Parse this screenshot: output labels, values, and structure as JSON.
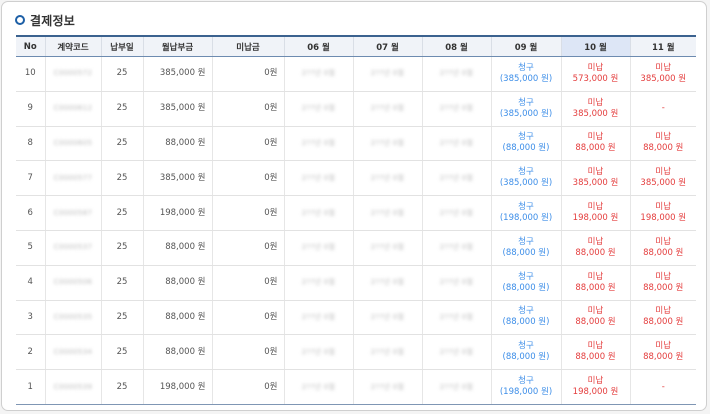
{
  "section": {
    "title": "결제정보"
  },
  "columns": [
    "No",
    "계약코드",
    "납부일",
    "월납부금",
    "미납금",
    "06 월",
    "07 월",
    "08 월",
    "09 월",
    "10 월",
    "11 월"
  ],
  "highlighted_column": "10 월",
  "colors": {
    "accent": "#3b628f",
    "billed": "#3d8ee8",
    "unpaid": "#e43d3d",
    "highlight": "#dde6f6"
  },
  "rows": [
    {
      "no": "10",
      "contract": "C0000572",
      "day": "25",
      "monthly": "385,000 원",
      "unpaid": "0원",
      "m06": "2??년 0월",
      "m07": "2??년 0월",
      "m08": "2??년 0월",
      "m09": {
        "status": "청구",
        "amount": "(385,000 원)"
      },
      "m10": {
        "status": "미납",
        "amount": "573,000 원"
      },
      "m11": {
        "status": "미납",
        "amount": "385,000 원"
      }
    },
    {
      "no": "9",
      "contract": "C0000612",
      "day": "25",
      "monthly": "385,000 원",
      "unpaid": "0원",
      "m06": "2??년 0월",
      "m07": "2??년 0월",
      "m08": "2??년 0월",
      "m09": {
        "status": "청구",
        "amount": "(385,000 원)"
      },
      "m10": {
        "status": "미납",
        "amount": "385,000 원"
      },
      "m11": {
        "status": "-",
        "amount": ""
      }
    },
    {
      "no": "8",
      "contract": "C0000605",
      "day": "25",
      "monthly": "88,000 원",
      "unpaid": "0원",
      "m06": "2??년 0월",
      "m07": "2??년 0월",
      "m08": "2??년 0월",
      "m09": {
        "status": "청구",
        "amount": "(88,000 원)"
      },
      "m10": {
        "status": "미납",
        "amount": "88,000 원"
      },
      "m11": {
        "status": "미납",
        "amount": "88,000 원"
      }
    },
    {
      "no": "7",
      "contract": "C0000577",
      "day": "25",
      "monthly": "385,000 원",
      "unpaid": "0원",
      "m06": "2??년 0월",
      "m07": "2??년 0월",
      "m08": "2??년 0월",
      "m09": {
        "status": "청구",
        "amount": "(385,000 원)"
      },
      "m10": {
        "status": "미납",
        "amount": "385,000 원"
      },
      "m11": {
        "status": "미납",
        "amount": "385,000 원"
      }
    },
    {
      "no": "6",
      "contract": "C0000587",
      "day": "25",
      "monthly": "198,000 원",
      "unpaid": "0원",
      "m06": "2??년 0월",
      "m07": "2??년 0월",
      "m08": "2??년 0월",
      "m09": {
        "status": "청구",
        "amount": "(198,000 원)"
      },
      "m10": {
        "status": "미납",
        "amount": "198,000 원"
      },
      "m11": {
        "status": "미납",
        "amount": "198,000 원"
      }
    },
    {
      "no": "5",
      "contract": "C0000537",
      "day": "25",
      "monthly": "88,000 원",
      "unpaid": "0원",
      "m06": "2??년 0월",
      "m07": "2??년 0월",
      "m08": "2??년 0월",
      "m09": {
        "status": "청구",
        "amount": "(88,000 원)"
      },
      "m10": {
        "status": "미납",
        "amount": "88,000 원"
      },
      "m11": {
        "status": "미납",
        "amount": "88,000 원"
      }
    },
    {
      "no": "4",
      "contract": "C0000506",
      "day": "25",
      "monthly": "88,000 원",
      "unpaid": "0원",
      "m06": "2??년 0월",
      "m07": "2??년 0월",
      "m08": "2??년 0월",
      "m09": {
        "status": "청구",
        "amount": "(88,000 원)"
      },
      "m10": {
        "status": "미납",
        "amount": "88,000 원"
      },
      "m11": {
        "status": "미납",
        "amount": "88,000 원"
      }
    },
    {
      "no": "3",
      "contract": "C0000535",
      "day": "25",
      "monthly": "88,000 원",
      "unpaid": "0원",
      "m06": "2??년 0월",
      "m07": "2??년 0월",
      "m08": "2??년 0월",
      "m09": {
        "status": "청구",
        "amount": "(88,000 원)"
      },
      "m10": {
        "status": "미납",
        "amount": "88,000 원"
      },
      "m11": {
        "status": "미납",
        "amount": "88,000 원"
      }
    },
    {
      "no": "2",
      "contract": "C0000534",
      "day": "25",
      "monthly": "88,000 원",
      "unpaid": "0원",
      "m06": "2??년 0월",
      "m07": "2??년 0월",
      "m08": "2??년 0월",
      "m09": {
        "status": "청구",
        "amount": "(88,000 원)"
      },
      "m10": {
        "status": "미납",
        "amount": "88,000 원"
      },
      "m11": {
        "status": "미납",
        "amount": "88,000 원"
      }
    },
    {
      "no": "1",
      "contract": "C0000539",
      "day": "25",
      "monthly": "198,000 원",
      "unpaid": "0원",
      "m06": "2??년 0월",
      "m07": "2??년 0월",
      "m08": "2??년 0월",
      "m09": {
        "status": "청구",
        "amount": "(198,000 원)"
      },
      "m10": {
        "status": "미납",
        "amount": "198,000 원"
      },
      "m11": {
        "status": "-",
        "amount": ""
      }
    }
  ]
}
